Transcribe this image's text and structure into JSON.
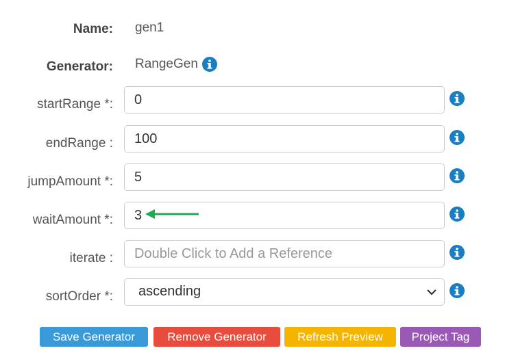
{
  "form": {
    "name_label": "Name:",
    "name_value": "gen1",
    "generator_label": "Generator:",
    "generator_value": "RangeGen",
    "fields": [
      {
        "label": "startRange *:",
        "value": "0",
        "placeholder": ""
      },
      {
        "label": "endRange :",
        "value": "100",
        "placeholder": ""
      },
      {
        "label": "jumpAmount *:",
        "value": "5",
        "placeholder": ""
      },
      {
        "label": "waitAmount *:",
        "value": "3",
        "placeholder": ""
      },
      {
        "label": "iterate :",
        "value": "",
        "placeholder": "Double Click to Add a Reference"
      }
    ],
    "sort": {
      "label": "sortOrder *:",
      "selected": "ascending"
    }
  },
  "buttons": {
    "save": "Save Generator",
    "remove": "Remove Generator",
    "refresh": "Refresh Preview",
    "tag": "Project Tag"
  },
  "colors": {
    "info": "#1a7fc1",
    "save": "#3a9ad9",
    "remove": "#e74c3c",
    "refresh": "#f5b400",
    "tag": "#9b59b6",
    "arrow": "#1fa855"
  },
  "icons": {
    "info": "info-circle-icon",
    "chevron": "chevron-down-icon",
    "arrow": "arrow-left-icon"
  }
}
